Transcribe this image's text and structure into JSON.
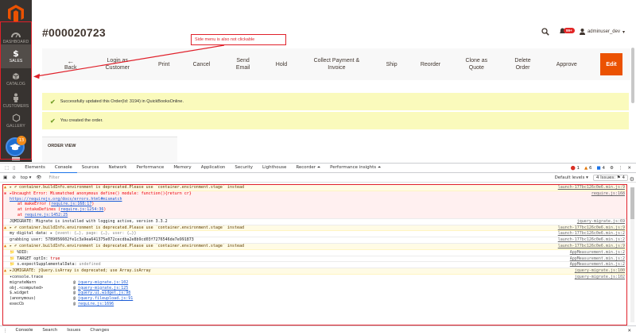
{
  "sidebar": {
    "items": [
      {
        "label": "DASHBOARD",
        "icon": "speedometer-icon"
      },
      {
        "label": "SALES",
        "icon": "dollar-icon"
      },
      {
        "label": "CATALOG",
        "icon": "box-icon"
      },
      {
        "label": "CUSTOMERS",
        "icon": "person-icon"
      },
      {
        "label": "GALLERY",
        "icon": "hexagon-icon"
      }
    ],
    "badge_count": "13"
  },
  "header": {
    "order_title": "#000020723",
    "notifications": "99+",
    "user": "adminuser_dev"
  },
  "annotation": {
    "text": "Side menu is also not clickable"
  },
  "actions": {
    "back": "Back",
    "login_as_customer": "Login as Customer",
    "print": "Print",
    "cancel": "Cancel",
    "send_email": "Send Email",
    "hold": "Hold",
    "collect_payment": "Collect Payment & Invoice",
    "ship": "Ship",
    "reorder": "Reorder",
    "clone_as_quote": "Clone as Quote",
    "delete_order": "Delete Order",
    "approve": "Approve",
    "edit": "Edit"
  },
  "messages": [
    "Successfully updated this Order(Id: 3194) in QuickBooksOnline.",
    "You created the order."
  ],
  "order_view": {
    "title": "ORDER VIEW"
  },
  "devtools": {
    "tabs": [
      "Elements",
      "Console",
      "Sources",
      "Network",
      "Performance",
      "Memory",
      "Application",
      "Security",
      "Lighthouse",
      "Recorder ⏶",
      "Performance insights ⏶"
    ],
    "errors": "1",
    "warnings": "6",
    "infos": "4",
    "context": "top ▾",
    "filter_placeholder": "Filter",
    "default_levels": "Default levels ▾",
    "issues": "4 Issues: ⚑ 4",
    "drawer_tabs": [
      "Console",
      "Search",
      "Issues",
      "Changes"
    ]
  },
  "console": {
    "l1": "▸ ✐ container.buildInfo.environment is deprecated.Please use `container.environment.stage` instead",
    "l1src": "launch-177bc126c0e6.min.js:9",
    "l2": "▸Uncaught Error: Mismatched anonymous define() module: function(){return cr}",
    "l2src": "require.js:168",
    "l3": "https://requirejs.org/docs/errors.html#mismatch",
    "l4a": "at makeError (",
    "l4b": "require.js:168:17",
    "l4c": ")",
    "l5a": "at intakeDefines (",
    "l5b": "require.js:1254:36",
    "l5c": ")",
    "l6a": "at ",
    "l6b": "require.js:1452:25",
    "l7": "JQMIGRATE: Migrate is installed with logging active, version 3.3.2",
    "l7src": "jquery-migrate.js:69",
    "l8": "▸ ✐ container.buildInfo.environment is deprecated.Please use `container.environment.stage` instead",
    "l8src": "launch-177bc126c0e6.min.js:9",
    "l9a": "my digital data:  ▸ ",
    "l9b": "{event: {…}, page: {…}, user: {…}}",
    "l9src": "launch-177bc126c0e6.min.js:2",
    "l10": "grabbing user:  5789056602fe1c3a9ea641375e072cecdba2e8b9cd03f7276546de7e991873",
    "l10src": "launch-177bc126c0e6.min.js:2",
    "l11": "▸ ✐ container.buildInfo.environment is deprecated.Please use `container.environment.stage` instead",
    "l11src": "launch-177bc126c0e6.min.js:9",
    "l12": "📁 %DID:",
    "l12src": "AppMeasurement.min.js:2",
    "l13a": "📁 TARGET optIn: ",
    "l13b": "true",
    "l13src": "AppMeasurement.min.js:2",
    "l14a": "📁 s.expectSupplementalData: ",
    "l14b": "undefined",
    "l14src": "AppMeasurement.min.js:2",
    "l15": "▸JQMIGRATE: jQuery.isArray is deprecated; use Array.isArray",
    "l15src": "jquery-migrate.js:100",
    "l16": "▾console.trace",
    "l16src": "jquery-migrate.js:102",
    "t1a": "migrateWarn",
    "t1b": "jquery-migrate.js:102",
    "t2a": "obj.<computed>",
    "t2b": "jquery-migrate.js:125",
    "t3a": "$.widget",
    "t3b": "jquery.ui.widget.js:98",
    "t4a": "(anonymous)",
    "t4b": "jquery.fileupload.js:91",
    "t5a": "execCb",
    "t5b": "require.js:1696"
  }
}
